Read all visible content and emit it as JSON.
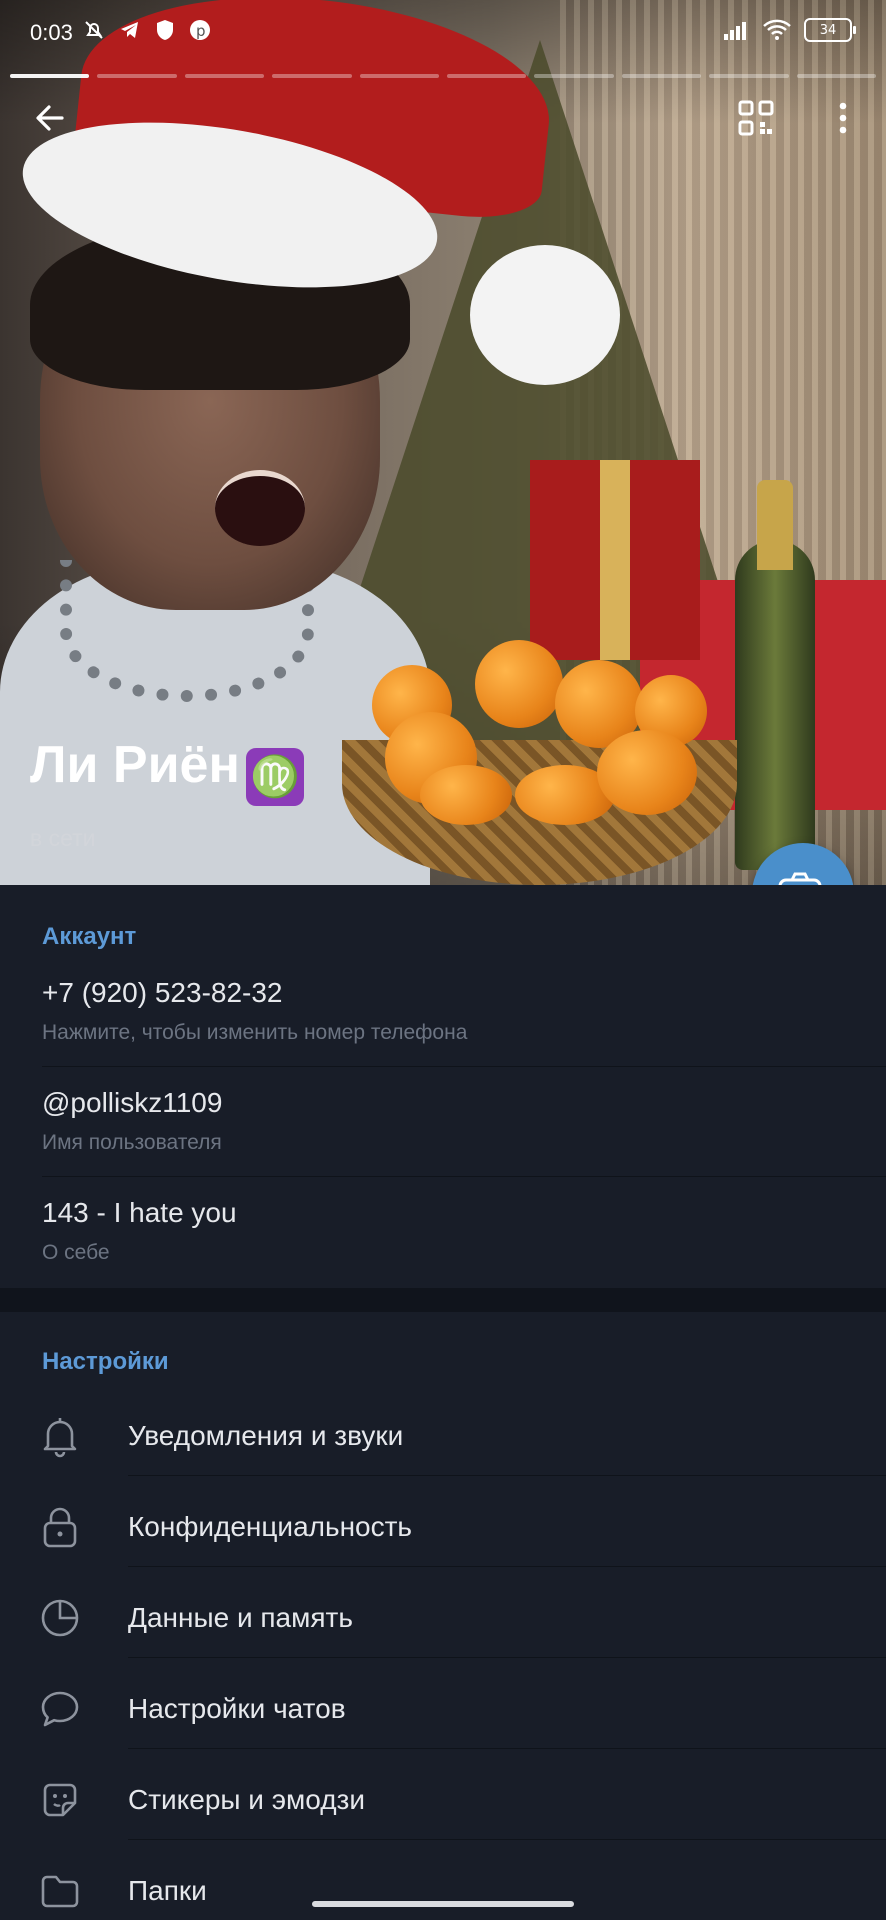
{
  "status_bar": {
    "time": "0:03",
    "battery": "34"
  },
  "profile": {
    "name": "Ли Риён",
    "zodiac": "♍",
    "status": "в сети"
  },
  "account": {
    "title": "Аккаунт",
    "items": [
      {
        "value": "+7 (920) 523-82-32",
        "label": "Нажмите, чтобы изменить номер телефона"
      },
      {
        "value": "@polliskz1109",
        "label": "Имя пользователя"
      },
      {
        "value": "143 - I hate you",
        "label": "О себе"
      }
    ]
  },
  "settings": {
    "title": "Настройки",
    "items": [
      {
        "label": "Уведомления и звуки",
        "icon": "bell-icon"
      },
      {
        "label": "Конфиденциальность",
        "icon": "lock-icon"
      },
      {
        "label": "Данные и память",
        "icon": "pie-chart-icon"
      },
      {
        "label": "Настройки чатов",
        "icon": "chat-bubble-icon"
      },
      {
        "label": "Стикеры и эмодзи",
        "icon": "sticker-icon"
      },
      {
        "label": "Папки",
        "icon": "folder-icon"
      }
    ]
  },
  "colors": {
    "accent": "#5d9ad7",
    "fab": "#4a8fcb",
    "background": "#181d28"
  }
}
